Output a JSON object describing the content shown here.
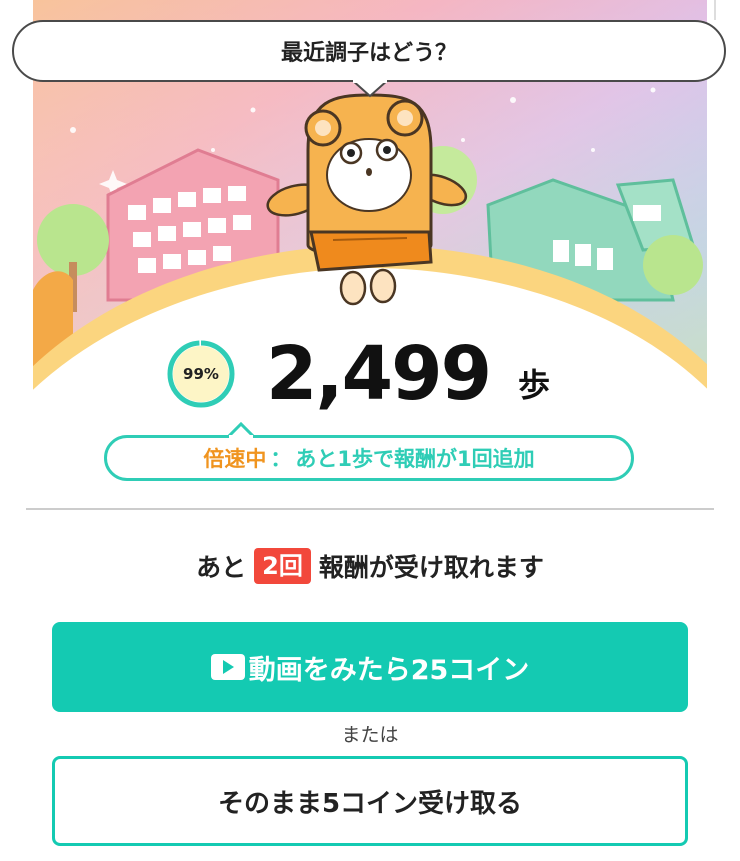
{
  "header": {
    "speech_bubble": "最近調子はどう？"
  },
  "steps": {
    "progress_label": "99%",
    "progress_fraction": 0.99,
    "count": "2,499",
    "unit": "歩"
  },
  "boost": {
    "status": "倍速中",
    "separator": "：",
    "message": "あと1歩で報酬が1回追加"
  },
  "rewards": {
    "prefix": "あと",
    "remaining_count": "2回",
    "suffix": "報酬が受け取れます"
  },
  "actions": {
    "video_button": "動画をみたら25コイン",
    "or_text": "または",
    "direct_button": "そのまま5コイン受け取る"
  },
  "colors": {
    "teal": "#14cab2",
    "ring": "#2fcdb6",
    "orange": "#f0941f",
    "badge_red": "#f2483b"
  },
  "icons": {
    "play": "play-icon",
    "mascot": "bear-mascot"
  }
}
